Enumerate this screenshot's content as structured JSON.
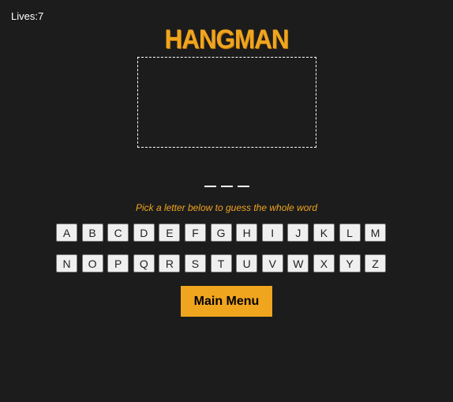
{
  "status": {
    "lives": "Lives:7"
  },
  "game": {
    "title": "HANGMAN",
    "blank_count": 3,
    "hint": "Pick a letter below to guess the whole word"
  },
  "keyboard": {
    "row1": [
      "A",
      "B",
      "C",
      "D",
      "E",
      "F",
      "G",
      "H",
      "I",
      "J",
      "K",
      "L",
      "M"
    ],
    "row2": [
      "N",
      "O",
      "P",
      "Q",
      "R",
      "S",
      "T",
      "U",
      "V",
      "W",
      "X",
      "Y",
      "Z"
    ]
  },
  "menu": {
    "main_menu_label": "Main Menu"
  },
  "colors": {
    "background": "#1c1c1c",
    "accent": "#f0a51f",
    "text": "#ffffff"
  }
}
